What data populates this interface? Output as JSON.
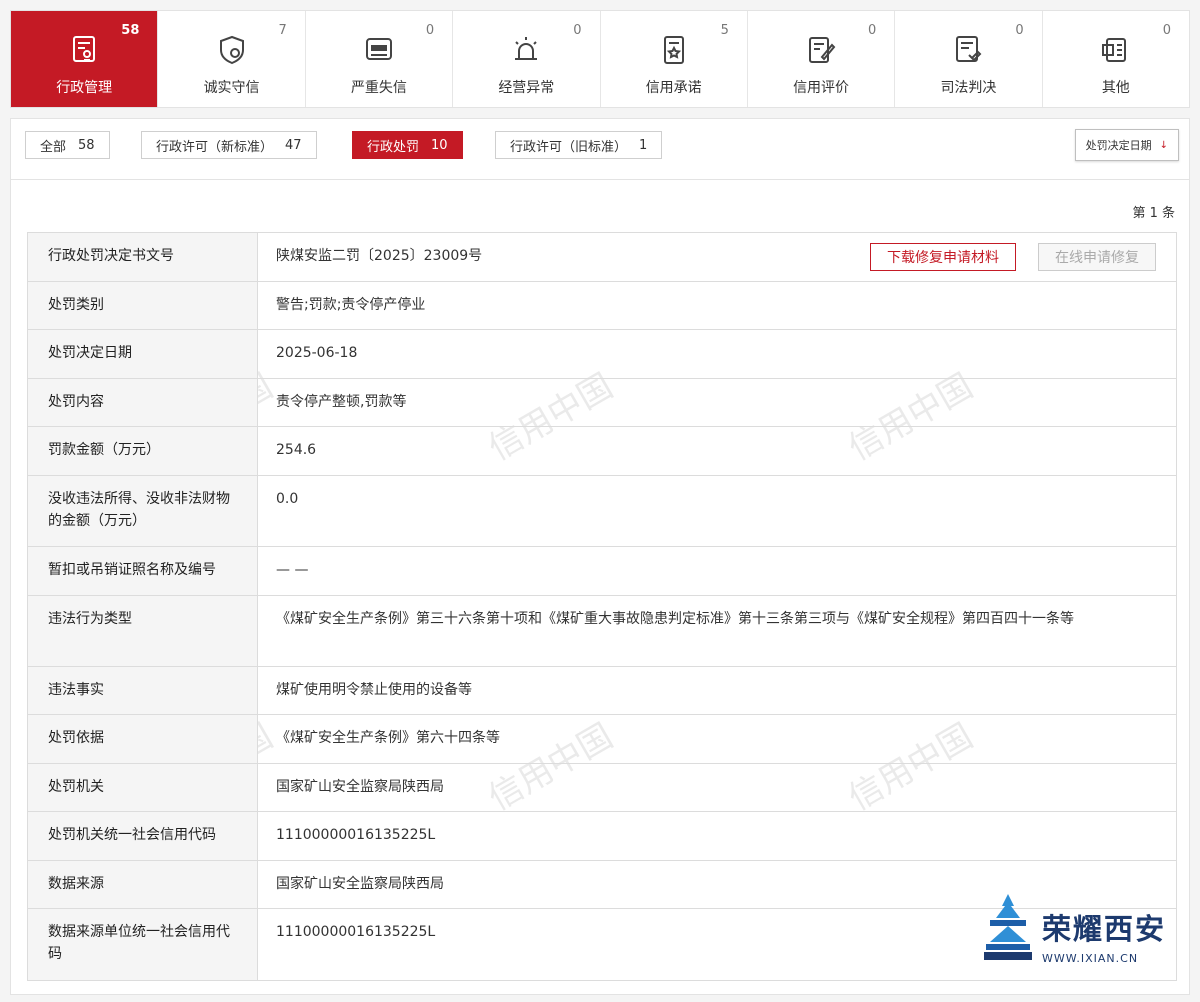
{
  "categories": [
    {
      "label": "行政管理",
      "count": "58",
      "icon": "admin-doc-icon",
      "active": true
    },
    {
      "label": "诚实守信",
      "count": "7",
      "icon": "shield-icon",
      "active": false
    },
    {
      "label": "严重失信",
      "count": "0",
      "icon": "blacklist-icon",
      "active": false
    },
    {
      "label": "经营异常",
      "count": "0",
      "icon": "alarm-icon",
      "active": false
    },
    {
      "label": "信用承诺",
      "count": "5",
      "icon": "promise-doc-icon",
      "active": false
    },
    {
      "label": "信用评价",
      "count": "0",
      "icon": "evaluation-icon",
      "active": false
    },
    {
      "label": "司法判决",
      "count": "0",
      "icon": "judgment-icon",
      "active": false
    },
    {
      "label": "其他",
      "count": "0",
      "icon": "other-icon",
      "active": false
    }
  ],
  "filters": [
    {
      "label": "全部",
      "count": "58",
      "active": false
    },
    {
      "label": "行政许可（新标准）",
      "count": "47",
      "active": false
    },
    {
      "label": "行政处罚",
      "count": "10",
      "active": true
    },
    {
      "label": "行政许可（旧标准）",
      "count": "1",
      "active": false
    }
  ],
  "sort": {
    "label": "处罚决定日期",
    "arrow": "↓"
  },
  "page_count": "第 1 条",
  "buttons": {
    "download": "下载修复申请材料",
    "online": "在线申请修复"
  },
  "rows": [
    {
      "key": "行政处罚决定书文号",
      "value": "陕煤安监二罚〔2025〕23009号"
    },
    {
      "key": "处罚类别",
      "value": "警告;罚款;责令停产停业"
    },
    {
      "key": "处罚决定日期",
      "value": "2025-06-18"
    },
    {
      "key": "处罚内容",
      "value": "责令停产整顿,罚款等"
    },
    {
      "key": "罚款金额（万元）",
      "value": "254.6"
    },
    {
      "key": "没收违法所得、没收非法财物的金额（万元）",
      "value": "0.0"
    },
    {
      "key": "暂扣或吊销证照名称及编号",
      "value": "— —"
    },
    {
      "key": "违法行为类型",
      "value": "《煤矿安全生产条例》第三十六条第十项和《煤矿重大事故隐患判定标准》第十三条第三项与《煤矿安全规程》第四百四十一条等"
    },
    {
      "key": "违法事实",
      "value": "煤矿使用明令禁止使用的设备等"
    },
    {
      "key": "处罚依据",
      "value": "《煤矿安全生产条例》第六十四条等"
    },
    {
      "key": "处罚机关",
      "value": "国家矿山安全监察局陕西局"
    },
    {
      "key": "处罚机关统一社会信用代码",
      "value": "11100000016135225L"
    },
    {
      "key": "数据来源",
      "value": "国家矿山安全监察局陕西局"
    },
    {
      "key": "数据来源单位统一社会信用代码",
      "value": "11100000016135225L"
    }
  ],
  "watermark": "信用中国",
  "corner_logo": {
    "title": "荣耀西安",
    "url": "WWW.IXIAN.CN"
  },
  "colors": {
    "accent": "#c41a25",
    "logo": "#1d3a6e"
  }
}
